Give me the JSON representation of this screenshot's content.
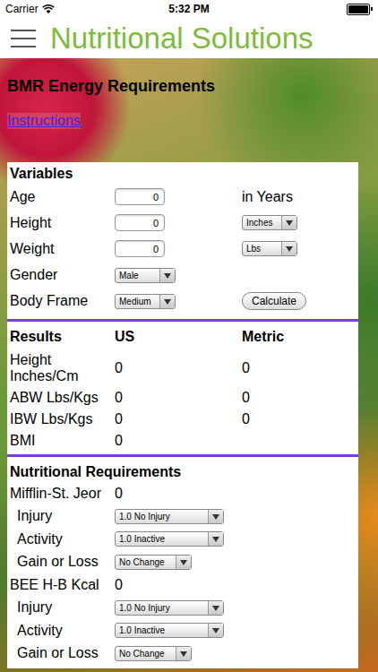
{
  "status_bar": {
    "carrier": "Carrier",
    "time": "5:32 PM"
  },
  "header": {
    "title": "Nutritional Solutions"
  },
  "page": {
    "title": "BMR Energy Requirements",
    "instructions_link": "Instructions"
  },
  "variables": {
    "heading": "Variables",
    "rows": [
      {
        "kind": "input",
        "label": "Age",
        "value": "0",
        "unit": "in Years"
      },
      {
        "kind": "input-select",
        "label": "Height",
        "value": "0",
        "select": "Inches"
      },
      {
        "kind": "input-select",
        "label": "Weight",
        "value": "0",
        "select": "Lbs"
      },
      {
        "kind": "select",
        "label": "Gender",
        "select": "Male"
      },
      {
        "kind": "select-button",
        "label": "Body Frame",
        "select": "Medium",
        "button": "Calculate"
      }
    ]
  },
  "results": {
    "columns": [
      "Results",
      "US",
      "Metric"
    ],
    "rows": [
      [
        "Height Inches/Cm",
        "0",
        "0"
      ],
      [
        "ABW Lbs/Kgs",
        "0",
        "0"
      ],
      [
        "IBW Lbs/Kgs",
        "0",
        "0"
      ],
      [
        "BMI",
        "0"
      ]
    ]
  },
  "nutrition": {
    "heading": "Nutritional Requirements",
    "rows": [
      {
        "kind": "value",
        "label": "Mifflin-St. Jeor",
        "value": "0"
      },
      {
        "kind": "select",
        "label": "Injury",
        "select": "1.0 No Injury"
      },
      {
        "kind": "select",
        "label": "Activity",
        "select": "1.0 Inactive"
      },
      {
        "kind": "select",
        "label": "Gain or Loss",
        "select": "No Change"
      },
      {
        "kind": "value",
        "label": "BEE H-B Kcal",
        "value": "0"
      },
      {
        "kind": "select",
        "label": "Injury",
        "select": "1.0 No Injury"
      },
      {
        "kind": "select",
        "label": "Activity",
        "select": "1.0 Inactive"
      },
      {
        "kind": "select",
        "label": "Gain or Loss",
        "select": "No Change"
      }
    ]
  }
}
